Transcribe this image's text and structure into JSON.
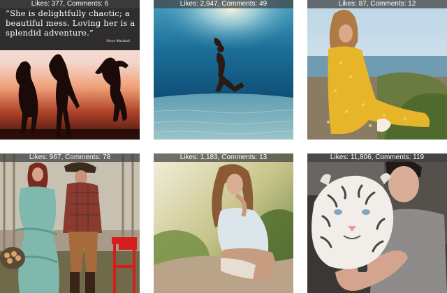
{
  "posts": [
    {
      "stats": "Likes: 377, Comments: 6",
      "quote": "“She is delightfully chaotic; a beautiful mess. Loving her is a splendid adventure.”",
      "author": "Steve Maraboli",
      "subject": "three dancing girl silhouettes at sunset"
    },
    {
      "stats": "Likes: 2,947, Comments: 49",
      "subject": "woman swimming underwater"
    },
    {
      "stats": "Likes: 87, Comments: 12",
      "subject": "woman in yellow dress by the sea"
    },
    {
      "stats": "Likes: 967, Comments: 78",
      "subject": "couple in western outfits with red chair"
    },
    {
      "stats": "Likes: 1,183, Comments: 13",
      "subject": "woman sitting on rock outdoors"
    },
    {
      "stats": "Likes: 11,806, Comments: 119",
      "subject": "man with white tiger"
    }
  ]
}
